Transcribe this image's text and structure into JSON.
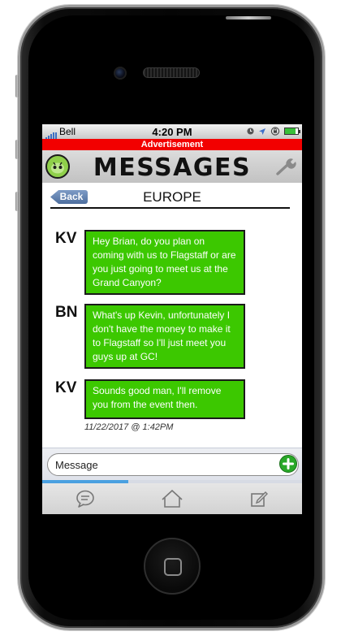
{
  "status_bar": {
    "carrier": "Bell",
    "time": "4:20 PM",
    "icons": [
      "clock-icon",
      "location-arrow-icon",
      "lock-rotation-icon",
      "battery-icon"
    ],
    "battery_level": 0.8
  },
  "ad_banner": {
    "text": "Advertisement",
    "color": "#f20000"
  },
  "header": {
    "title": "MESSAGES",
    "app_icon": "android-face-icon",
    "settings_icon": "wrench-icon"
  },
  "nav": {
    "back_label": "Back",
    "title": "EUROPE"
  },
  "messages": [
    {
      "sender": "KV",
      "text": "Hey Brian, do you plan on coming with us to Flagstaff or are you just going to meet us at the Grand Canyon?"
    },
    {
      "sender": "BN",
      "text": "What's up Kevin, unfortunately I don't have the money to make it to Flagstaff so I'll just meet you guys up at GC!"
    },
    {
      "sender": "KV",
      "text": "Sounds good man, I'll remove you from the event then."
    }
  ],
  "last_timestamp": "11/22/2017 @ 1:42PM",
  "composer": {
    "placeholder": "Message",
    "send_icon": "plus-circle-icon"
  },
  "progress": 0.33,
  "tabs": [
    {
      "icon": "chat-bubble-icon"
    },
    {
      "icon": "home-icon"
    },
    {
      "icon": "compose-icon"
    }
  ],
  "colors": {
    "bubble": "#3cc800",
    "accent": "#4aa0e0",
    "back_button": "#5b7bab"
  }
}
